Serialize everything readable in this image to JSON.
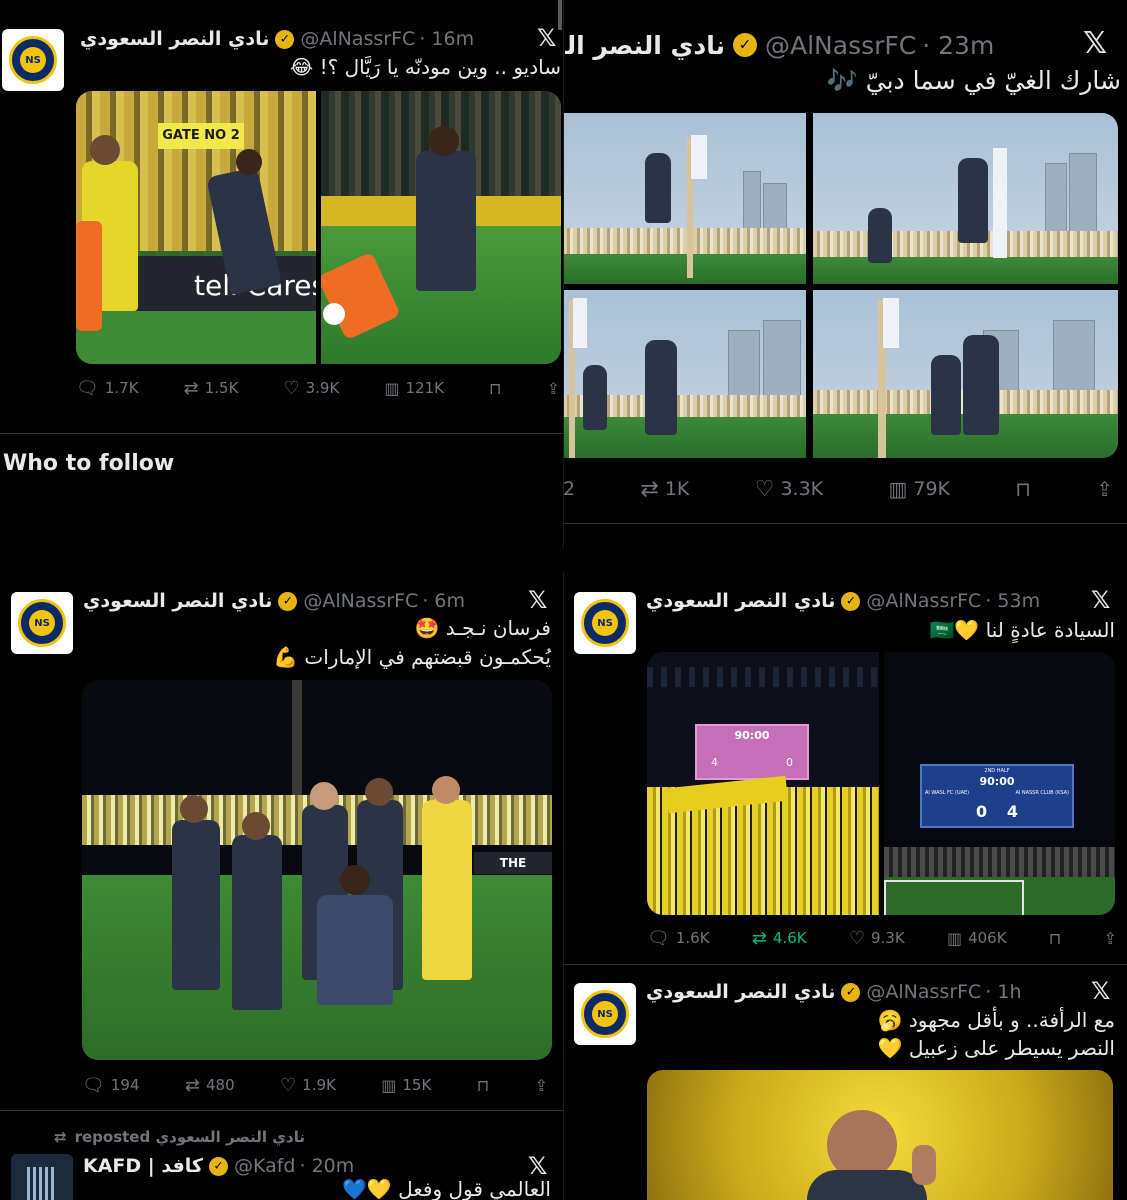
{
  "colors": {
    "background": "#000000",
    "text": "#e7e9ea",
    "muted": "#71767b",
    "verified": "#e8b40f",
    "retweet_active": "#00ba7c",
    "nassr_yellow": "#f2c40d",
    "nassr_blue": "#0c2a66"
  },
  "icons": {
    "reply": "speech-bubble",
    "repost": "repost-arrows",
    "like": "heart",
    "views": "bar-chart",
    "bookmark": "bookmark",
    "share": "share-arrow",
    "x": "x-logo",
    "verified": "verified-badge"
  },
  "post1": {
    "name": "نادي النصر السعودي",
    "handle": "@AlNassrFC",
    "time": "· 16m",
    "text": "ساديو .. وين مودنّه يا رَيَّال ؟! 😂",
    "overlay_text": "tell Cares",
    "gate_text": "GATE NO 2",
    "stats": {
      "replies": "1.7K",
      "reposts": "1.5K",
      "likes": "3.9K",
      "views": "121K"
    }
  },
  "who_to_follow": "Who to follow",
  "post2": {
    "name": "نادي النصر السعودي",
    "handle": "@AlNassrFC",
    "time": "· 23m",
    "text": "شارك الغيّ في سما دبيّ 🎶",
    "stats": {
      "replies": "2",
      "reposts": "1K",
      "likes": "3.3K",
      "views": "79K"
    }
  },
  "post3": {
    "name": "نادي النصر السعودي",
    "handle": "@AlNassrFC",
    "time": "· 6m",
    "text_line1": "فرسان نـجـد 🤩",
    "text_line2": "يُحكمـون قبضتهم في الإمارات 💪",
    "board_text": "THE OFFICIAL",
    "stats": {
      "replies": "194",
      "reposts": "480",
      "likes": "1.9K",
      "views": "15K"
    }
  },
  "repost": {
    "label": "reposted نادي النصر السعودي",
    "name": "KAFD | كافد",
    "handle": "@Kafd",
    "time": "· 20m",
    "text": "العالمي قول وفعل 💛💙"
  },
  "post4": {
    "name": "نادي النصر السعودي",
    "handle": "@AlNassrFC",
    "time": "· 53m",
    "text": "السيادة عادةٍ لنا 💛🇸🇦",
    "scoreboard1": {
      "time": "90:00",
      "home": "4",
      "away": "0"
    },
    "scoreboard2": {
      "label": "2ND HALF",
      "time": "90:00",
      "left_team": "Al WASL FC (UAE)",
      "right_team": "Al NASSR CLUB (KSA)",
      "left_score": "0",
      "right_score": "4"
    },
    "stats": {
      "replies": "1.6K",
      "reposts": "4.6K",
      "likes": "9.3K",
      "views": "406K"
    }
  },
  "post5": {
    "name": "نادي النصر السعودي",
    "handle": "@AlNassrFC",
    "time": "· 1h",
    "text_line1": "مع الرأفة.. و بأقل مجهود 🥱",
    "text_line2": "النصر يسيطر على زعبيل 💛"
  }
}
